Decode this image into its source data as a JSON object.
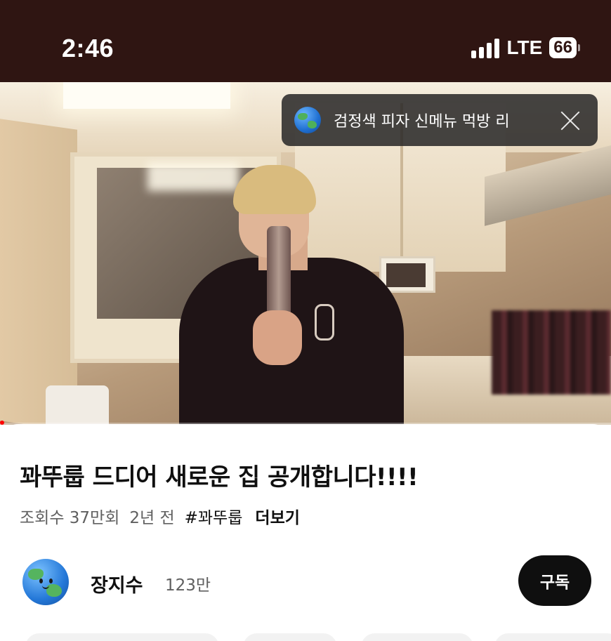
{
  "status_bar": {
    "time": "2:46",
    "network": "LTE",
    "battery": "66"
  },
  "mini_player": {
    "title": "검정색 피자 신메뉴 먹방 리"
  },
  "video": {
    "title": "꽈뚜룹 드디어 새로운 집 공개합니다!!!!",
    "views": "조회수 37만회",
    "age": "2년 전",
    "hashtag": "#꽈뚜룹",
    "more": "더보기"
  },
  "channel": {
    "name": "장지수",
    "subscribers": "123만",
    "subscribe_label": "구독"
  },
  "colors": {
    "status_bar_bg": "#2f1512",
    "subscribe_bg": "#0f0f0f",
    "progress": "#ff0000"
  }
}
